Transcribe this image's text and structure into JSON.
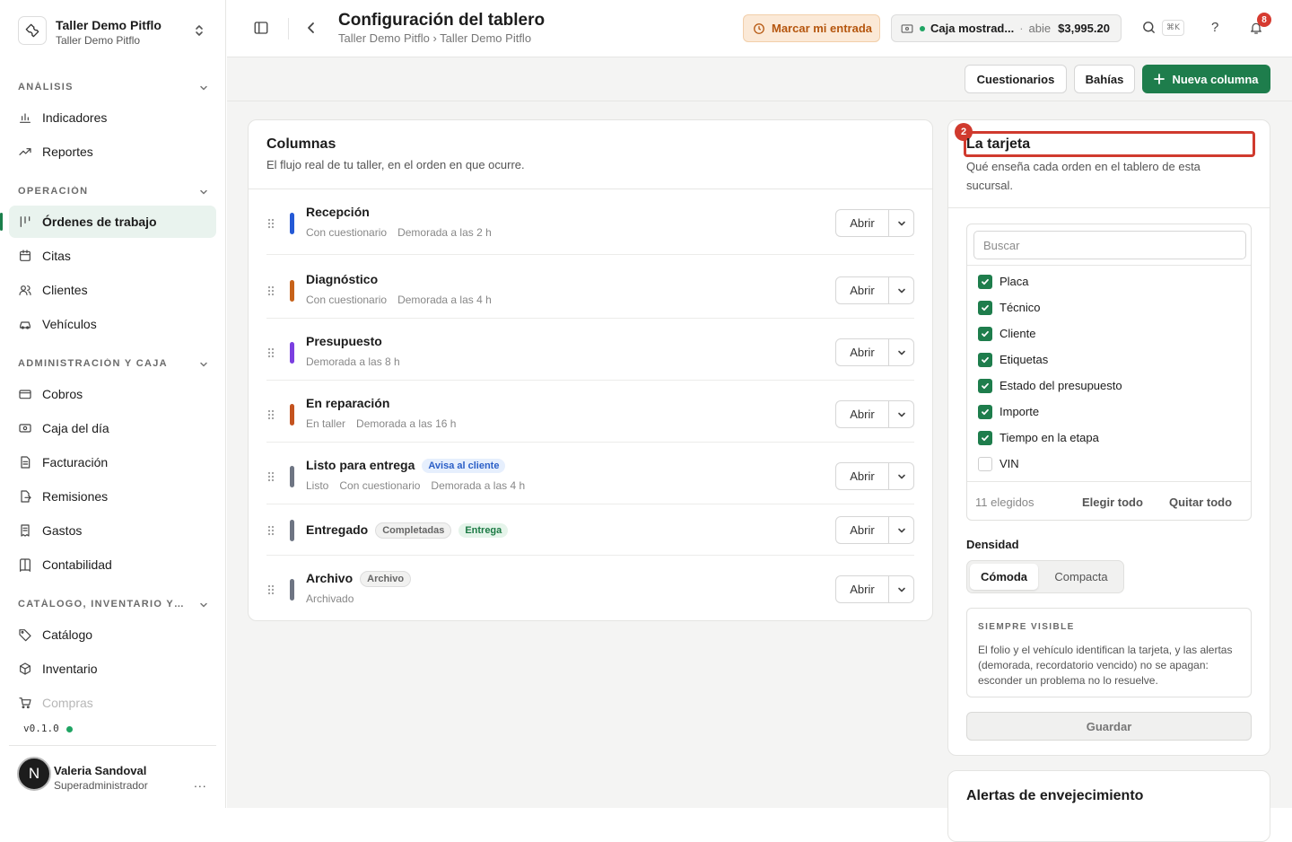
{
  "org": {
    "name": "Taller Demo Pitflo",
    "subtitle": "Taller Demo Pitflo"
  },
  "sidebar": {
    "sections": [
      {
        "label": "ANÁLISIS",
        "items": [
          {
            "label": "Indicadores",
            "icon": "bar-chart-icon"
          },
          {
            "label": "Reportes",
            "icon": "trending-up-icon"
          }
        ]
      },
      {
        "label": "OPERACIÓN",
        "items": [
          {
            "label": "Órdenes de trabajo",
            "icon": "kanban-icon",
            "active": true
          },
          {
            "label": "Citas",
            "icon": "calendar-icon"
          },
          {
            "label": "Clientes",
            "icon": "users-icon"
          },
          {
            "label": "Vehículos",
            "icon": "car-icon"
          }
        ]
      },
      {
        "label": "ADMINISTRACIÓN Y CAJA",
        "items": [
          {
            "label": "Cobros",
            "icon": "wallet-icon"
          },
          {
            "label": "Caja del día",
            "icon": "cash-icon"
          },
          {
            "label": "Facturación",
            "icon": "invoice-icon"
          },
          {
            "label": "Remisiones",
            "icon": "file-export-icon"
          },
          {
            "label": "Gastos",
            "icon": "receipt-icon"
          },
          {
            "label": "Contabilidad",
            "icon": "book-icon"
          }
        ]
      },
      {
        "label": "CATÁLOGO, INVENTARIO Y COMPRAS",
        "items": [
          {
            "label": "Catálogo",
            "icon": "tag-icon"
          },
          {
            "label": "Inventario",
            "icon": "box-icon"
          },
          {
            "label": "Compras",
            "icon": "cart-icon"
          }
        ]
      }
    ],
    "version": "v0.1.0"
  },
  "user": {
    "initial": "N",
    "name": "Valeria Sandoval",
    "role": "Superadministrador",
    "more": "..."
  },
  "topbar": {
    "title": "Configuración del tablero",
    "breadcrumb": "Taller Demo Pitflo › Taller Demo Pitflo",
    "clock_in": "Marcar mi entrada",
    "cashbox": {
      "name": "Caja mostrad...",
      "separator": "·",
      "status": "abie",
      "amount": "$3,995.20"
    },
    "shortcut": "⌘K",
    "help": "?",
    "notifications": "8"
  },
  "actions": {
    "questionnaires": "Cuestionarios",
    "bays": "Bahías",
    "new_column": "Nueva columna"
  },
  "columns": {
    "title": "Columnas",
    "description": "El flujo real de tu taller, en el orden en que ocurre.",
    "open_label": "Abrir",
    "rows": [
      {
        "name": "Recepción",
        "color": "#2459d6",
        "meta": [
          "Con cuestionario",
          "Demorada a las 2 h"
        ],
        "pills": []
      },
      {
        "name": "Diagnóstico",
        "color": "#c7621a",
        "meta": [
          "Con cuestionario",
          "Demorada a las 4 h"
        ],
        "pills": []
      },
      {
        "name": "Presupuesto",
        "color": "#7b3fe0",
        "meta": [
          "Demorada a las 8 h"
        ],
        "pills": []
      },
      {
        "name": "En reparación",
        "color": "#c4531f",
        "meta": [
          "En taller",
          "Demorada a las 16 h"
        ],
        "pills": []
      },
      {
        "name": "Listo para entrega",
        "color": "#6e7583",
        "meta": [
          "Listo",
          "Con cuestionario",
          "Demorada a las 4 h"
        ],
        "pills": [
          {
            "text": "Avisa al cliente",
            "style": "blue"
          }
        ]
      },
      {
        "name": "Entregado",
        "color": "#6e7583",
        "meta": [],
        "pills": [
          {
            "text": "Completadas",
            "style": "gray"
          },
          {
            "text": "Entrega",
            "style": "green"
          }
        ]
      },
      {
        "name": "Archivo",
        "color": "#6e7583",
        "meta": [
          "Archivado"
        ],
        "pills": [
          {
            "text": "Archivo",
            "style": "gray"
          }
        ]
      }
    ]
  },
  "card": {
    "title": "La tarjeta",
    "annotation": "2",
    "description": "Qué enseña cada orden en el tablero de esta sucursal.",
    "search_placeholder": "Buscar",
    "fields": [
      {
        "label": "Placa",
        "checked": true
      },
      {
        "label": "Técnico",
        "checked": true
      },
      {
        "label": "Cliente",
        "checked": true
      },
      {
        "label": "Etiquetas",
        "checked": true
      },
      {
        "label": "Estado del presupuesto",
        "checked": true
      },
      {
        "label": "Importe",
        "checked": true
      },
      {
        "label": "Tiempo en la etapa",
        "checked": true
      },
      {
        "label": "VIN",
        "checked": false
      }
    ],
    "count": "11 elegidos",
    "select_all": "Elegir todo",
    "clear_all": "Quitar todo",
    "density_label": "Densidad",
    "density_options": [
      "Cómoda",
      "Compacta"
    ],
    "density_selected": "Cómoda",
    "always_visible_title": "SIEMPRE VISIBLE",
    "always_visible_text": "El folio y el vehículo identifican la tarjeta, y las alertas (demorada, recordatorio vencido) no se apagan: esconder un problema no lo resuelve.",
    "save": "Guardar"
  },
  "aging": {
    "title": "Alertas de envejecimiento"
  }
}
